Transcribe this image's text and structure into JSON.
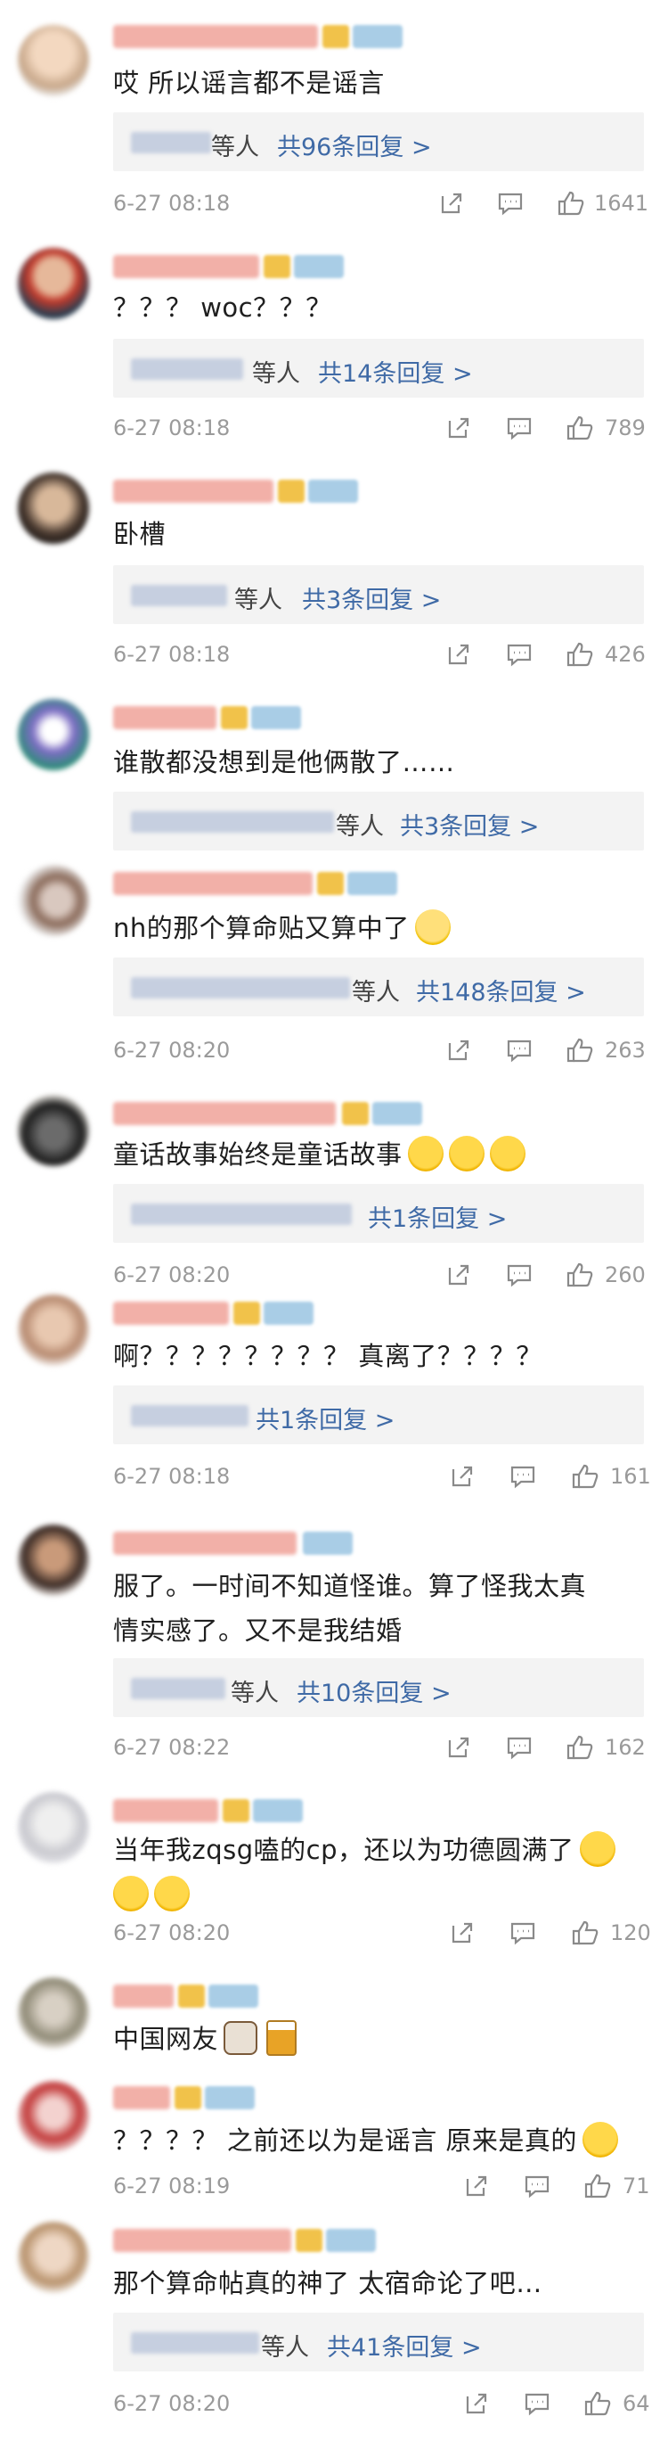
{
  "comments": [
    {
      "text": "哎 所以谣言都不是谣言",
      "reply_who": "等人",
      "reply_link": "共96条回复 >",
      "time": "6-27 08:18",
      "likes": "1641"
    },
    {
      "text": "？？？ woc？？？",
      "reply_who": "等人",
      "reply_link": "共14条回复 >",
      "time": "6-27 08:18",
      "likes": "789"
    },
    {
      "text": "卧槽",
      "reply_who": "等人",
      "reply_link": "共3条回复 >",
      "time": "6-27 08:18",
      "likes": "426"
    },
    {
      "text": "谁散都没想到是他俩散了……",
      "reply_who": "等人",
      "reply_link": "共3条回复 >"
    },
    {
      "text": "nh的那个算命贴又算中了",
      "reply_who": "等人",
      "reply_link": "共148条回复 >",
      "time": "6-27 08:20",
      "likes": "263"
    },
    {
      "text": "童话故事始终是童话故事",
      "reply_who": "",
      "reply_link": "共1条回复 >",
      "time": "6-27 08:20",
      "likes": "260"
    },
    {
      "text": "啊？？？？？？？？ 真离了？？？？",
      "reply_who": "",
      "reply_link": "共1条回复 >",
      "time": "6-27 08:18",
      "likes": "161"
    },
    {
      "text": "服了。一时间不知道怪谁。算了怪我太真情实感了。又不是我结婚",
      "reply_who": "等人",
      "reply_link": "共10条回复 >",
      "time": "6-27 08:22",
      "likes": "162"
    },
    {
      "text": "当年我zqsg嗑的cp，还以为功德圆满了",
      "time": "6-27 08:20",
      "likes": "120"
    },
    {
      "text": "中国网友"
    },
    {
      "text": "？？？？ 之前还以为是谣言 原来是真的",
      "time": "6-27 08:19",
      "likes": "71"
    },
    {
      "text": "那个算命帖真的神了 太宿命论了吧…",
      "reply_who": "等人",
      "reply_link": "共41条回复 >",
      "time": "6-27 08:20",
      "likes": "64"
    }
  ],
  "colors": {
    "link": "#3f6aa6",
    "meta": "#9a9a9a",
    "reply_bg": "#f3f3f3"
  },
  "icons": [
    "share-icon",
    "comment-icon",
    "like-icon"
  ]
}
